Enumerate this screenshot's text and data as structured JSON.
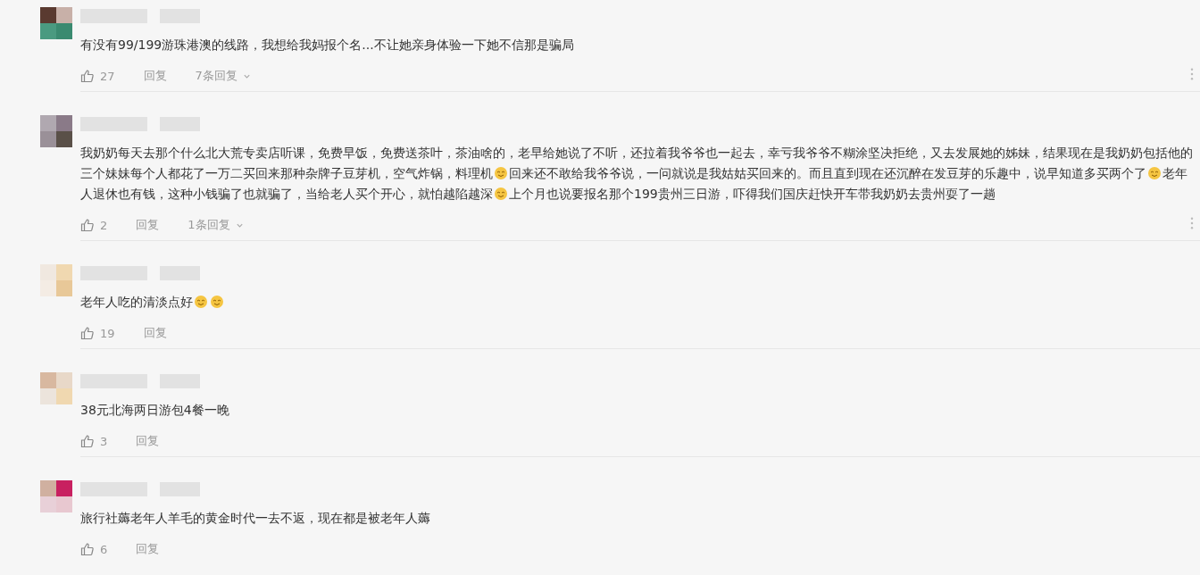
{
  "comments": [
    {
      "content": [
        {
          "kind": "text",
          "text": "有没有99/199游珠港澳的线路，我想给我妈报个名...不让她亲身体验一下她不信那是骗局"
        }
      ],
      "likes": "27",
      "reply": "回复",
      "reply_count": "7条回复",
      "has_menu": true
    },
    {
      "content": [
        {
          "kind": "text",
          "text": "我奶奶每天去那个什么北大荒专卖店听课，免费早饭，免费送茶叶，茶油啥的，老早给她说了不听，还拉着我爷爷也一起去，幸亏我爷爷不糊涂坚决拒绝，又去发展她的姊妹，结果现在是我奶奶包括他的三个妹妹每个人都花了一万二买回来那种杂牌子豆芽机，空气炸锅，料理机"
        },
        {
          "kind": "emoji"
        },
        {
          "kind": "text",
          "text": "回来还不敢给我爷爷说，一问就说是我姑姑买回来的。而且直到现在还沉醉在发豆芽的乐趣中，说早知道多买两个了"
        },
        {
          "kind": "emoji"
        },
        {
          "kind": "text",
          "text": "老年人退休也有钱，这种小钱骗了也就骗了，当给老人买个开心，就怕越陷越深"
        },
        {
          "kind": "emoji"
        },
        {
          "kind": "text",
          "text": "上个月也说要报名那个199贵州三日游，吓得我们国庆赶快开车带我奶奶去贵州耍了一趟"
        }
      ],
      "likes": "2",
      "reply": "回复",
      "reply_count": "1条回复",
      "has_menu": true
    },
    {
      "content": [
        {
          "kind": "text",
          "text": "老年人吃的清淡点好"
        },
        {
          "kind": "emoji"
        },
        {
          "kind": "emoji"
        }
      ],
      "likes": "19",
      "reply": "回复",
      "has_menu": false
    },
    {
      "content": [
        {
          "kind": "text",
          "text": "38元北海两日游包4餐一晚"
        }
      ],
      "likes": "3",
      "reply": "回复",
      "has_menu": false
    },
    {
      "content": [
        {
          "kind": "text",
          "text": "旅行社薅老年人羊毛的黄金时代一去不返，现在都是被老年人薅"
        }
      ],
      "likes": "6",
      "reply": "回复",
      "has_menu": false
    }
  ]
}
